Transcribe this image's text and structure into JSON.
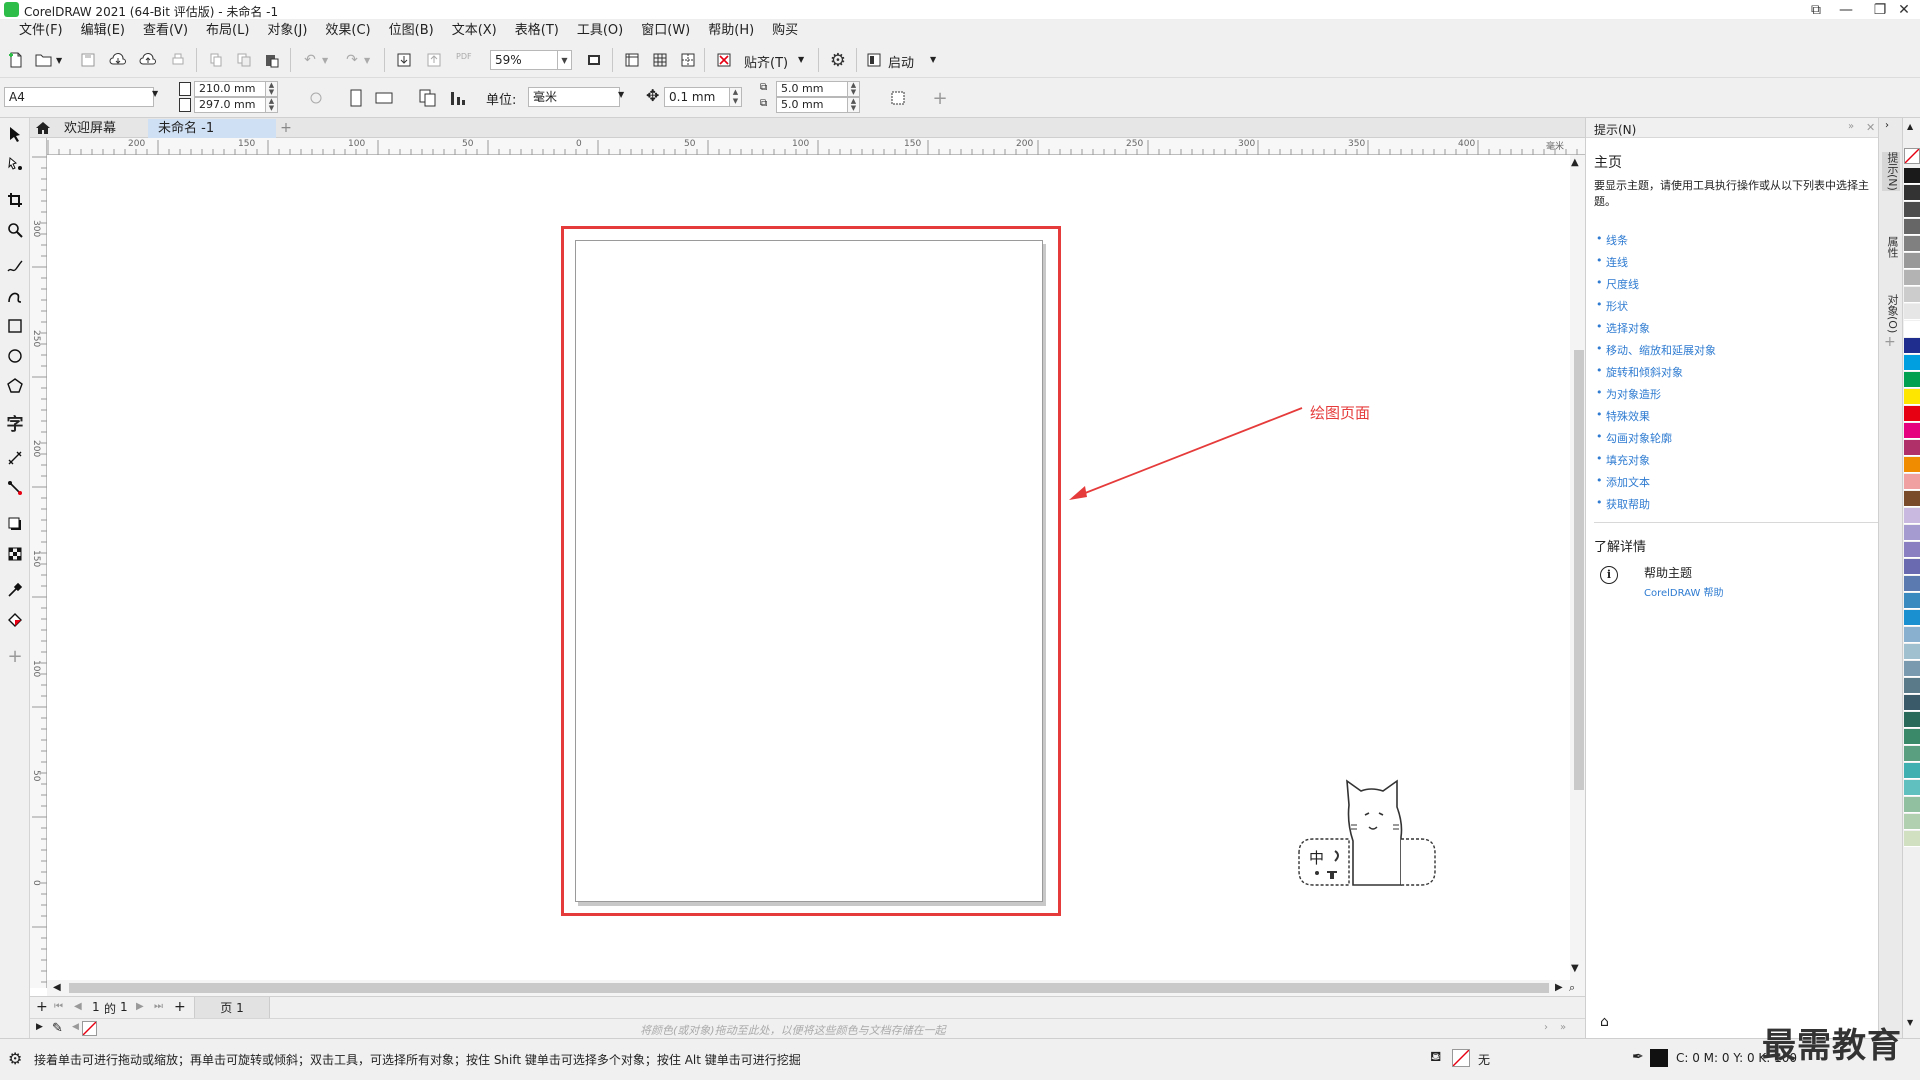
{
  "window": {
    "title": "CorelDRAW 2021 (64-Bit 评估版) - 未命名 -1",
    "buttons": [
      "⧉",
      "—",
      "❐",
      "✕"
    ]
  },
  "menu": [
    "文件(F)",
    "编辑(E)",
    "查看(V)",
    "布局(L)",
    "对象(J)",
    "效果(C)",
    "位图(B)",
    "文本(X)",
    "表格(T)",
    "工具(O)",
    "窗口(W)",
    "帮助(H)",
    "购买"
  ],
  "toolbar1": {
    "zoom": "59%",
    "snap_label": "贴齐(T)",
    "launch_label": "启动",
    "pdf_label": "PDF"
  },
  "toolbar2": {
    "page_size": "A4",
    "width": "210.0 mm",
    "height": "297.0 mm",
    "unit_label": "单位:",
    "unit_value": "毫米",
    "nudge": "0.1 mm",
    "dup_x": "5.0 mm",
    "dup_y": "5.0 mm"
  },
  "tabs": {
    "welcome": "欢迎屏幕",
    "document": "未命名 -1"
  },
  "rulers": {
    "h_ticks": [
      "200",
      "150",
      "100",
      "50",
      "0",
      "50",
      "100",
      "150",
      "200",
      "250",
      "300",
      "350",
      "400"
    ],
    "h_unit": "毫米",
    "v_ticks": [
      "300",
      "250",
      "200",
      "150",
      "100",
      "50",
      "0"
    ]
  },
  "canvas": {
    "annotation": "绘图页面",
    "ime_text": "中",
    "colors": {
      "highlight": "#e63b3b",
      "annotation": "#e63b3b"
    }
  },
  "pagenav": {
    "current": "1",
    "of": "的",
    "total": "1",
    "page_tab": "页 1"
  },
  "colordock_hint": "将颜色(或对象)拖动至此处，以便将这些颜色与文档存储在一起",
  "status": {
    "message": "接着单击可进行拖动或缩放；再单击可旋转或倾斜；双击工具，可选择所有对象；按住 Shift 键单击可选择多个对象；按住 Alt 键单击可进行挖掘",
    "fill_label": "无",
    "cmyk": "C: 0 M: 0 Y: 0 K: 100"
  },
  "docker": {
    "title": "提示(N)",
    "home": "主页",
    "intro": "要显示主题，请使用工具执行操作或从以下列表中选择主题。",
    "links": [
      "线条",
      "连线",
      "尺度线",
      "形状",
      "选择对象",
      "移动、缩放和延展对象",
      "旋转和倾斜对象",
      "为对象造形",
      "特殊效果",
      "勾画对象轮廓",
      "填充对象",
      "添加文本",
      "获取帮助"
    ],
    "learn_more": "了解详情",
    "help_topic": "帮助主题",
    "help_link": "CorelDRAW 帮助"
  },
  "docker_tabs": [
    "提示(N)",
    "属性",
    "对象(O)"
  ],
  "palette": [
    "#1a1a1a",
    "#333333",
    "#4d4d4d",
    "#666666",
    "#808080",
    "#999999",
    "#b3b3b3",
    "#cccccc",
    "#e6e6e6",
    "#ffffff",
    "#1f2d8f",
    "#00a0e0",
    "#00a050",
    "#ffe600",
    "#e60012",
    "#e4007f",
    "#b0306a",
    "#f08c00",
    "#f0a0a0",
    "#7a4b2a",
    "#c9b8e0",
    "#a59bd0",
    "#8a7fc0",
    "#6a6ab0",
    "#5a7ab0",
    "#3a8ac0",
    "#1a90d0",
    "#8ab0d0",
    "#a0c0d0",
    "#7a9ab0",
    "#5a7a8a",
    "#3a5a6a",
    "#2a6a5a",
    "#3a8a6a",
    "#5aa080",
    "#40b0b0",
    "#60c0c0",
    "#90c0a0",
    "#b0d0b0",
    "#d0e0c0"
  ],
  "watermark": "最需教育"
}
